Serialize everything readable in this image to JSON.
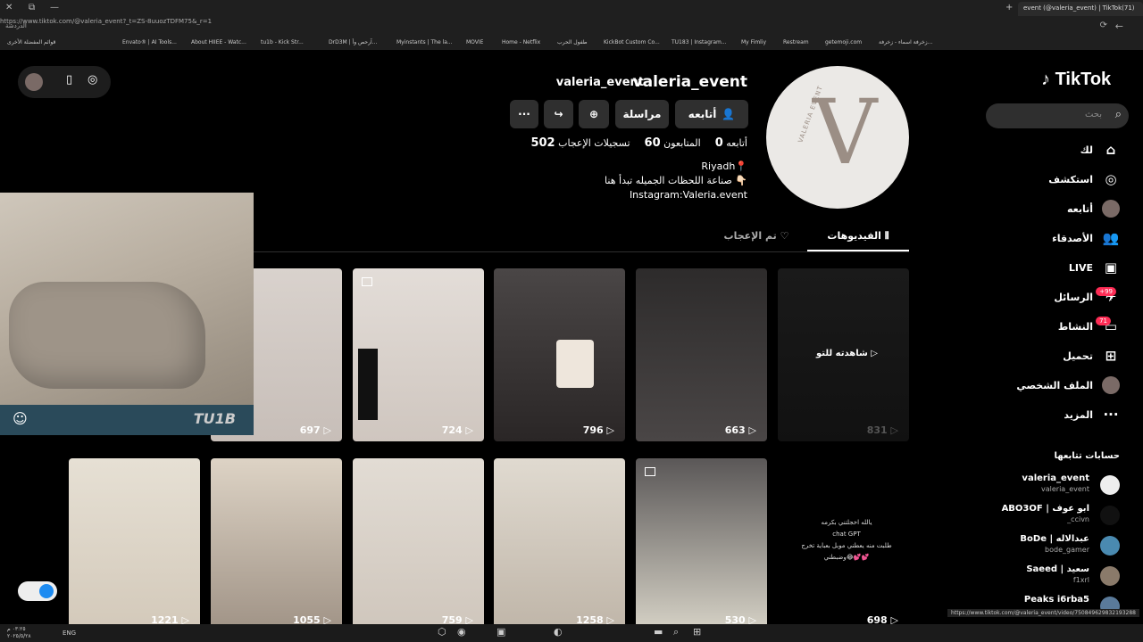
{
  "browser": {
    "tab_title": "event (@valeria_event) | TikTok(71)",
    "url": "https://www.tiktok.com/@valeria_event?_t=ZS-8uuozTDFM75&_r=1",
    "bookmarks": [
      "Envato® | AI Tools...",
      "About HIIEE - Watc...",
      "tu1b - Kick Str...",
      "DrD3M | آرحص وأ...",
      "Myinstants | The la...",
      "MOVIE",
      "Home - Netflix",
      "طفول الحرب",
      "KickBot Custom Co...",
      "TU183 | Instagram...",
      "My Fimliy",
      "Restream",
      "getemoji.com",
      "زخرفة اسماء - زخرفة..."
    ],
    "bookmarks_right": "قوائم المفضلة الأخرى",
    "profile_label": "الدردشة"
  },
  "sidebar": {
    "logo": "TikTok",
    "search_placeholder": "بحث",
    "items": [
      {
        "label": "لك",
        "icon": "home-icon"
      },
      {
        "label": "استكشف",
        "icon": "compass-icon"
      },
      {
        "label": "أتابعه",
        "icon": "avatar-icon"
      },
      {
        "label": "الأصدقاء",
        "icon": "friends-icon"
      },
      {
        "label": "LIVE",
        "icon": "live-icon"
      },
      {
        "label": "الرسائل",
        "icon": "messages-icon",
        "badge": "+99"
      },
      {
        "label": "النشاط",
        "icon": "activity-icon",
        "badge": "71"
      },
      {
        "label": "تحميل",
        "icon": "upload-icon"
      },
      {
        "label": "الملف الشخصي",
        "icon": "profile-avatar-icon"
      },
      {
        "label": "المزيد",
        "icon": "more-icon"
      }
    ],
    "following_title": "حسابات تتابعها",
    "following": [
      {
        "name": "valeria_event",
        "handle": "valeria_event"
      },
      {
        "name": "ABO3OF | ابو عوف",
        "handle": "_ccivn"
      },
      {
        "name": "BoDe | عبدالاله",
        "handle": "bode_gamer"
      },
      {
        "name": "Saeed | سعيد",
        "handle": "f1xrl"
      },
      {
        "name": "Peaks i6rba5",
        "handle": ""
      }
    ]
  },
  "profile": {
    "username": "valeria_event",
    "nickname": "valeria_event",
    "follow_button": "أتابعه",
    "message_button": "مراسلة",
    "following_count": "0",
    "following_label": "أتابعه",
    "followers_count": "60",
    "followers_label": "المتابعون",
    "likes_count": "502",
    "likes_label": "تسجيلات الإعجاب",
    "bio_line1": "Riyadh📍",
    "bio_line2": "صناعة اللحظات الجميله تبدأ هنا 👇🏻",
    "bio_line3": "Instagram:Valeria.event",
    "avatar_text": "VALERIA EVENT"
  },
  "tabs": {
    "videos": "الفيديوهات",
    "liked": "تم الإعجاب"
  },
  "videos_row1": [
    "697",
    "724",
    "796",
    "663",
    "831"
  ],
  "videos_row2": [
    "1221",
    "1055",
    "759",
    "1258",
    "530",
    "698"
  ],
  "watched_label": "شاهدته للتو",
  "gpt_card": {
    "line1": "يالله  اخجلتني بكرمه",
    "line2": "chat GPT",
    "line3": "طلبت منه يعطني موبل بعباية تخرج",
    "line4": "وضبطني😂💕💕"
  },
  "overlay": {
    "label": "TU1B"
  },
  "status_url": "https://www.tiktok.com/@valeria_event/video/7508496298321932​88",
  "taskbar": {
    "lang": "ENG",
    "time": "٠٣:٢٥ م",
    "date": "٢٠٢٥/٥/٢٨"
  }
}
